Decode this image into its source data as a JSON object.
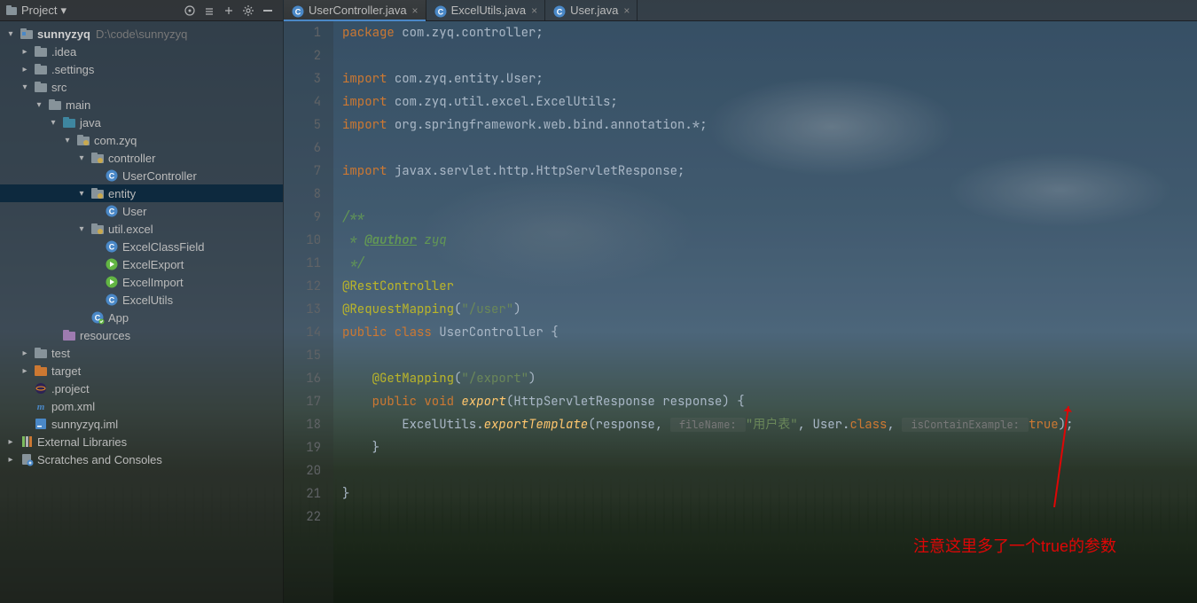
{
  "sidebar": {
    "header": {
      "title": "Project",
      "icons": [
        "target-icon",
        "expand-icon",
        "collapse-icon",
        "gear-icon",
        "hide-icon"
      ]
    },
    "tree": [
      {
        "d": 0,
        "tw": "open",
        "ic": "module",
        "label": "sunnyzyq",
        "path": "D:\\code\\sunnyzyq",
        "bold": true
      },
      {
        "d": 1,
        "tw": "closed",
        "ic": "folder",
        "label": ".idea"
      },
      {
        "d": 1,
        "tw": "closed",
        "ic": "folder",
        "label": ".settings"
      },
      {
        "d": 1,
        "tw": "open",
        "ic": "folder",
        "label": "src"
      },
      {
        "d": 2,
        "tw": "open",
        "ic": "folder",
        "label": "main"
      },
      {
        "d": 3,
        "tw": "open",
        "ic": "src",
        "label": "java"
      },
      {
        "d": 4,
        "tw": "open",
        "ic": "pkg",
        "label": "com.zyq"
      },
      {
        "d": 5,
        "tw": "open",
        "ic": "pkg",
        "label": "controller"
      },
      {
        "d": 6,
        "tw": "none",
        "ic": "class",
        "label": "UserController"
      },
      {
        "d": 5,
        "tw": "open",
        "ic": "pkg",
        "label": "entity",
        "sel": true
      },
      {
        "d": 6,
        "tw": "none",
        "ic": "class",
        "label": "User"
      },
      {
        "d": 5,
        "tw": "open",
        "ic": "pkg",
        "label": "util.excel"
      },
      {
        "d": 6,
        "tw": "none",
        "ic": "class",
        "label": "ExcelClassField"
      },
      {
        "d": 6,
        "tw": "none",
        "ic": "run",
        "label": "ExcelExport"
      },
      {
        "d": 6,
        "tw": "none",
        "ic": "run",
        "label": "ExcelImport"
      },
      {
        "d": 6,
        "tw": "none",
        "ic": "class",
        "label": "ExcelUtils"
      },
      {
        "d": 5,
        "tw": "none",
        "ic": "app",
        "label": "App"
      },
      {
        "d": 3,
        "tw": "none",
        "ic": "res",
        "label": "resources"
      },
      {
        "d": 1,
        "tw": "closed",
        "ic": "folder",
        "label": "test"
      },
      {
        "d": 1,
        "tw": "closed",
        "ic": "target",
        "label": "target"
      },
      {
        "d": 1,
        "tw": "none",
        "ic": "eclipse",
        "label": ".project"
      },
      {
        "d": 1,
        "tw": "none",
        "ic": "maven",
        "label": "pom.xml",
        "mcolor": "#4A88C7"
      },
      {
        "d": 1,
        "tw": "none",
        "ic": "ij",
        "label": "sunnyzyq.iml"
      },
      {
        "d": 0,
        "tw": "closed",
        "ic": "lib",
        "label": "External Libraries"
      },
      {
        "d": 0,
        "tw": "closed",
        "ic": "scratch",
        "label": "Scratches and Consoles"
      }
    ]
  },
  "tabs": [
    {
      "label": "UserController.java",
      "active": true
    },
    {
      "label": "ExcelUtils.java",
      "active": false
    },
    {
      "label": "User.java",
      "active": false
    }
  ],
  "code": {
    "lines": [
      [
        {
          "t": "package ",
          "c": "k"
        },
        {
          "t": "com.zyq.controller",
          "c": "n"
        },
        {
          "t": ";",
          "c": "p"
        }
      ],
      [],
      [
        {
          "t": "import ",
          "c": "k"
        },
        {
          "t": "com.zyq.entity.User",
          "c": "n"
        },
        {
          "t": ";",
          "c": "p"
        }
      ],
      [
        {
          "t": "import ",
          "c": "k"
        },
        {
          "t": "com.zyq.util.excel.ExcelUtils",
          "c": "n"
        },
        {
          "t": ";",
          "c": "p"
        }
      ],
      [
        {
          "t": "import ",
          "c": "k"
        },
        {
          "t": "org.springframework.web.bind.annotation.*",
          "c": "n"
        },
        {
          "t": ";",
          "c": "p"
        }
      ],
      [],
      [
        {
          "t": "import ",
          "c": "k"
        },
        {
          "t": "javax.servlet.http.HttpServletResponse",
          "c": "n"
        },
        {
          "t": ";",
          "c": "p"
        }
      ],
      [],
      [
        {
          "t": "/**",
          "c": "c"
        }
      ],
      [
        {
          "t": " * ",
          "c": "c"
        },
        {
          "t": "@author",
          "c": "cb"
        },
        {
          "t": " zyq",
          "c": "c"
        }
      ],
      [
        {
          "t": " */",
          "c": "c"
        }
      ],
      [
        {
          "t": "@RestController",
          "c": "a"
        }
      ],
      [
        {
          "t": "@RequestMapping",
          "c": "a"
        },
        {
          "t": "(",
          "c": "p"
        },
        {
          "t": "\"/user\"",
          "c": "s"
        },
        {
          "t": ")",
          "c": "p"
        }
      ],
      [
        {
          "t": "public class ",
          "c": "k"
        },
        {
          "t": "UserController ",
          "c": "n"
        },
        {
          "t": "{",
          "c": "p"
        }
      ],
      [],
      [
        {
          "t": "    ",
          "c": "n"
        },
        {
          "t": "@GetMapping",
          "c": "a"
        },
        {
          "t": "(",
          "c": "p"
        },
        {
          "t": "\"/export\"",
          "c": "s"
        },
        {
          "t": ")",
          "c": "p"
        }
      ],
      [
        {
          "t": "    ",
          "c": "n"
        },
        {
          "t": "public void ",
          "c": "k"
        },
        {
          "t": "export",
          "c": "f"
        },
        {
          "t": "(HttpServletResponse response) {",
          "c": "p"
        }
      ],
      [
        {
          "t": "        ExcelUtils.",
          "c": "n"
        },
        {
          "t": "exportTemplate",
          "c": "f"
        },
        {
          "t": "(response, ",
          "c": "p"
        },
        {
          "t": " fileName: ",
          "c": "hint"
        },
        {
          "t": "\"用户表\"",
          "c": "s"
        },
        {
          "t": ", User.",
          "c": "n"
        },
        {
          "t": "class",
          "c": "k"
        },
        {
          "t": ", ",
          "c": "p"
        },
        {
          "t": " isContainExample: ",
          "c": "hint"
        },
        {
          "t": "true",
          "c": "hl-true"
        },
        {
          "t": ");",
          "c": "p"
        }
      ],
      [
        {
          "t": "    }",
          "c": "p"
        }
      ],
      [],
      [
        {
          "t": "}",
          "c": "p"
        }
      ],
      []
    ]
  },
  "annotation": {
    "text": "注意这里多了一个true的参数"
  }
}
